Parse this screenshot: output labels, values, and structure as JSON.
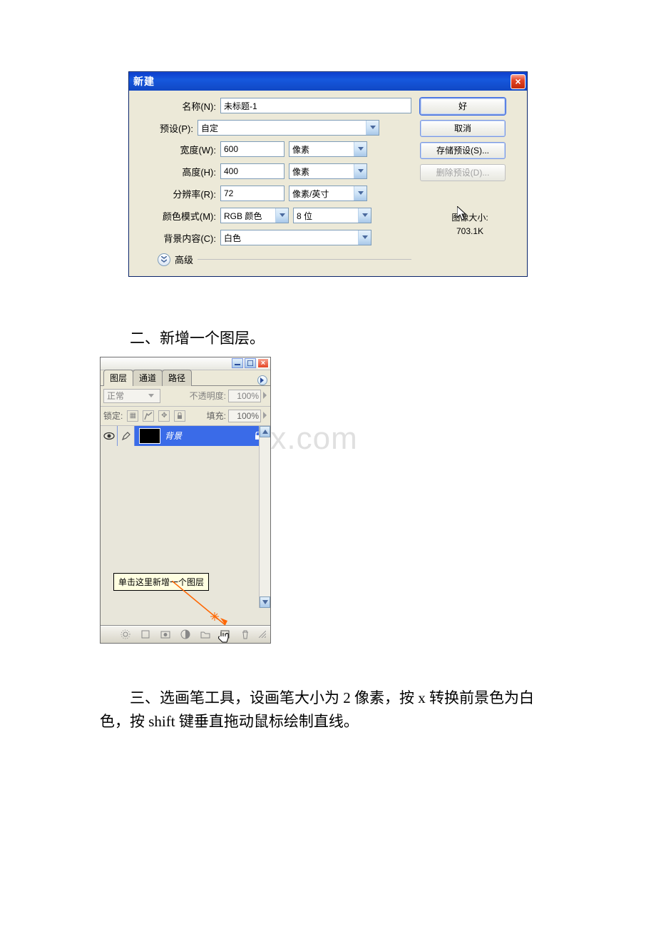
{
  "dialog_new": {
    "title": "新建",
    "labels": {
      "name": "名称(N):",
      "preset": "预设(P):",
      "width": "宽度(W):",
      "height": "高度(H):",
      "resolution": "分辨率(R):",
      "color_mode": "颜色模式(M):",
      "bg_content": "背景内容(C):",
      "advanced": "高级"
    },
    "values": {
      "name": "未标题-1",
      "preset": "自定",
      "width": "600",
      "height": "400",
      "resolution": "72",
      "color_mode": "RGB 颜色",
      "color_depth": "8 位",
      "bg_content": "白色"
    },
    "units": {
      "width": "像素",
      "height": "像素",
      "resolution": "像素/英寸"
    },
    "buttons": {
      "ok": "好",
      "cancel": "取消",
      "save_preset": "存储预设(S)...",
      "delete_preset": "删除预设(D)..."
    },
    "image_size": {
      "label": "图像大小:",
      "value": "703.1K"
    }
  },
  "paragraphs": {
    "p2": "二、新增一个图层。",
    "p3": "三、选画笔工具，设画笔大小为 2 像素，按 x 转换前景色为白色，按 shift 键垂直拖动鼠标绘制直线。"
  },
  "layers_panel": {
    "tabs": {
      "layers": "图层",
      "channels": "通道",
      "paths": "路径"
    },
    "blend_mode": "正常",
    "opacity_label": "不透明度:",
    "opacity_value": "100%",
    "lock_label": "锁定:",
    "fill_label": "填充:",
    "fill_value": "100%",
    "layer_name": "背景",
    "tooltip": "单击这里新增一个图层"
  },
  "watermark": "odocx.com"
}
